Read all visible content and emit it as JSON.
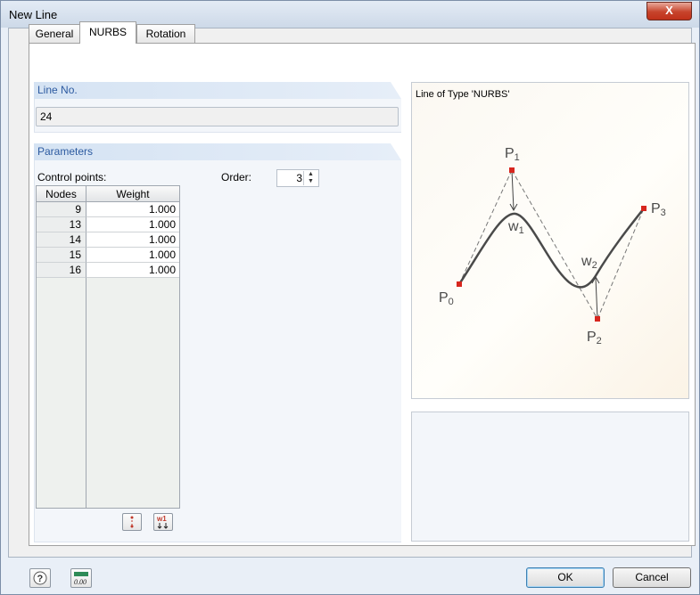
{
  "window": {
    "title": "New Line",
    "close_glyph": "X"
  },
  "tabs": [
    {
      "label": "General",
      "active": false
    },
    {
      "label": "NURBS",
      "active": true
    },
    {
      "label": "Rotation",
      "active": false
    }
  ],
  "line_no": {
    "header": "Line No.",
    "value": "24"
  },
  "parameters": {
    "header": "Parameters",
    "control_points_label": "Control points:",
    "order_label": "Order:",
    "order_value": "3",
    "columns": [
      "Nodes",
      "Weight"
    ],
    "rows": [
      {
        "node": "9",
        "weight": "1.000"
      },
      {
        "node": "13",
        "weight": "1.000"
      },
      {
        "node": "14",
        "weight": "1.000"
      },
      {
        "node": "15",
        "weight": "1.000"
      },
      {
        "node": "16",
        "weight": "1.000"
      }
    ],
    "weight_button_label": "w1"
  },
  "preview": {
    "title": "Line of Type 'NURBS'",
    "points": {
      "p0": "P",
      "p1": "P",
      "p2": "P",
      "p3": "P",
      "sub0": "0",
      "sub1": "1",
      "sub2": "2",
      "sub3": "3"
    },
    "weights": {
      "w1": "w",
      "w2": "w",
      "wsub1": "1",
      "wsub2": "2"
    }
  },
  "footer": {
    "ok_label": "OK",
    "cancel_label": "Cancel",
    "units_icon_text": "0.00"
  },
  "colors": {
    "accent": "#2c5aa0",
    "control_point": "#d7261e"
  }
}
